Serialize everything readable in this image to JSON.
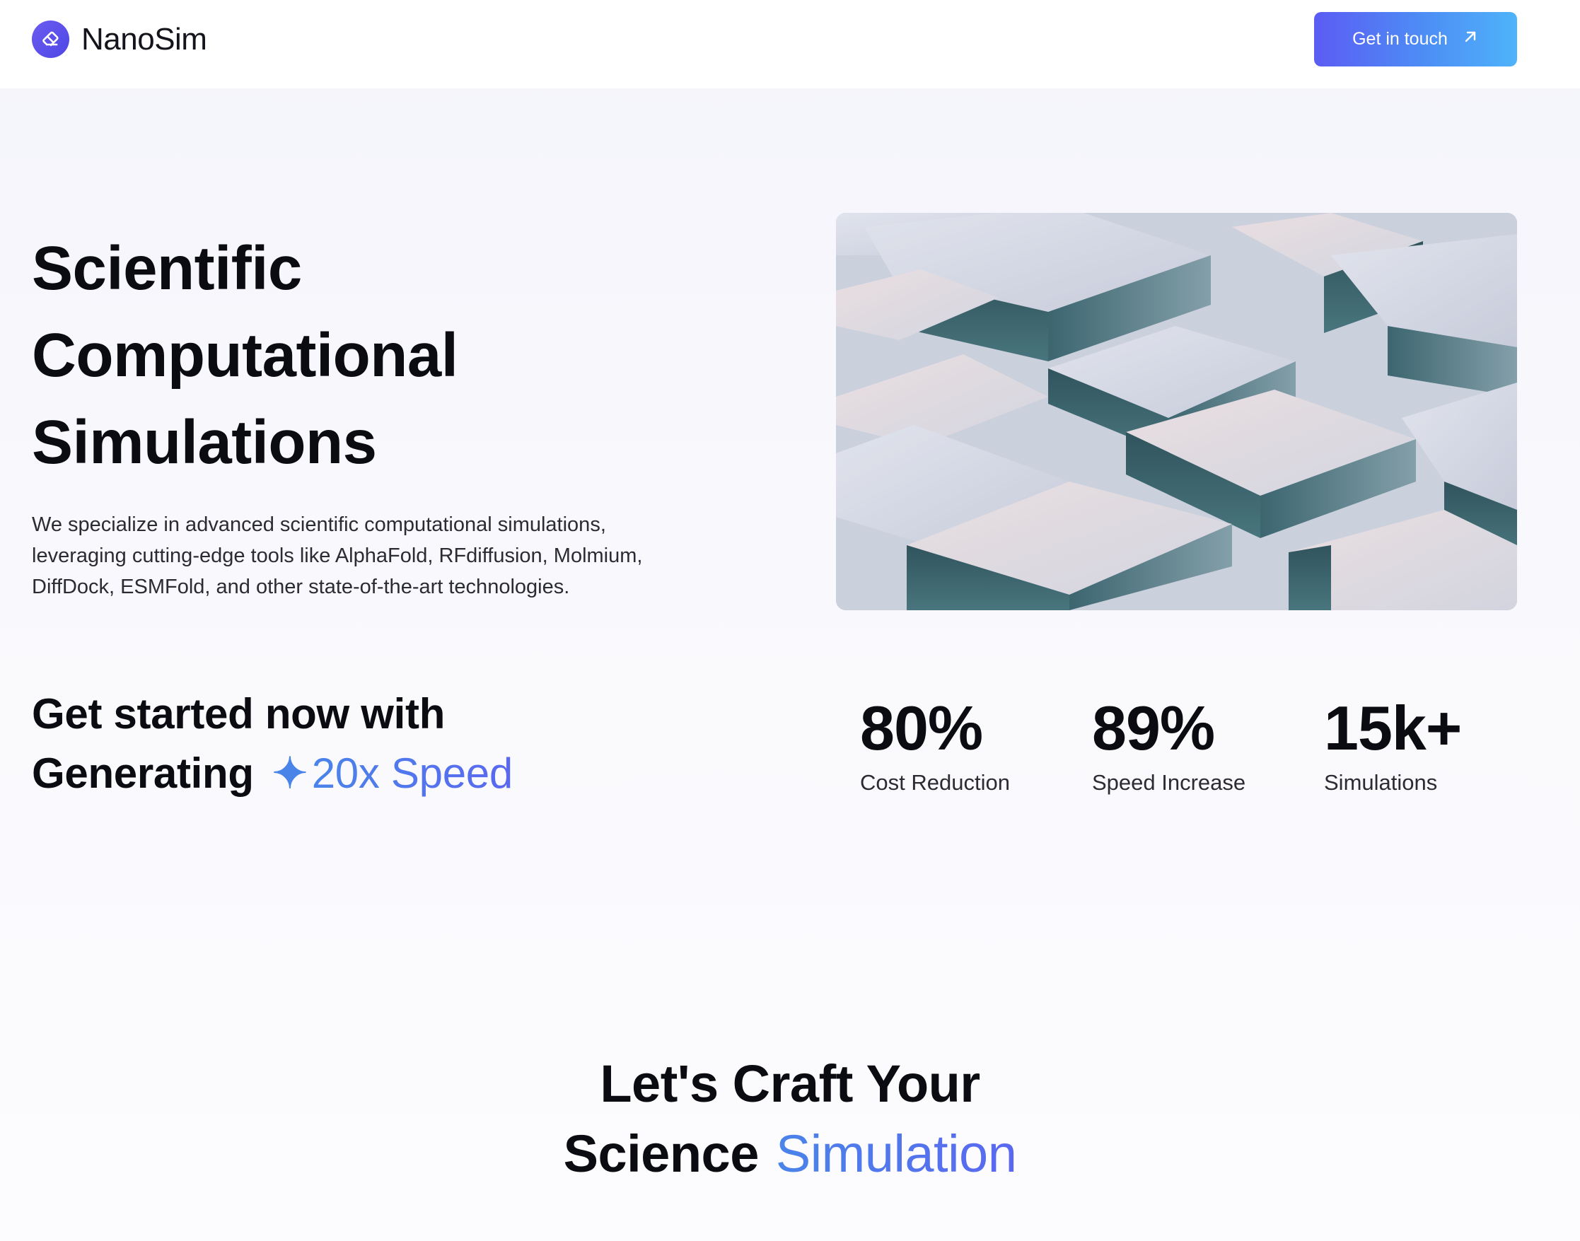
{
  "header": {
    "brand_name": "NanoSim",
    "cta_label": "Get in touch"
  },
  "hero": {
    "title_lines": [
      "Scientific",
      "Computational",
      "Simulations"
    ],
    "description_lines": [
      "We specialize in advanced scientific computational simulations,",
      "leveraging cutting-edge tools like AlphaFold, RFdiffusion, Molmium,",
      "DiffDock, ESMFold, and other state-of-the-art technologies."
    ]
  },
  "get_started": {
    "line1": "Get started now with",
    "line2_prefix": "Generating",
    "sparkle": "✦",
    "line2_accent": "20x Speed"
  },
  "stats": [
    {
      "value": "80%",
      "label": "Cost Reduction"
    },
    {
      "value": "89%",
      "label": "Speed Increase"
    },
    {
      "value": "15k+",
      "label": "Simulations"
    }
  ],
  "craft": {
    "line1": "Let's Craft Your",
    "line2_prefix": "Science",
    "line2_accent": "Simulation"
  },
  "colors": {
    "brand": "#4e46e5",
    "accent_blue": "#4a84e9",
    "accent_indigo": "#5a68f0"
  },
  "icons": [
    "eraser-icon",
    "arrow-up-right-icon",
    "sparkle-icon"
  ]
}
